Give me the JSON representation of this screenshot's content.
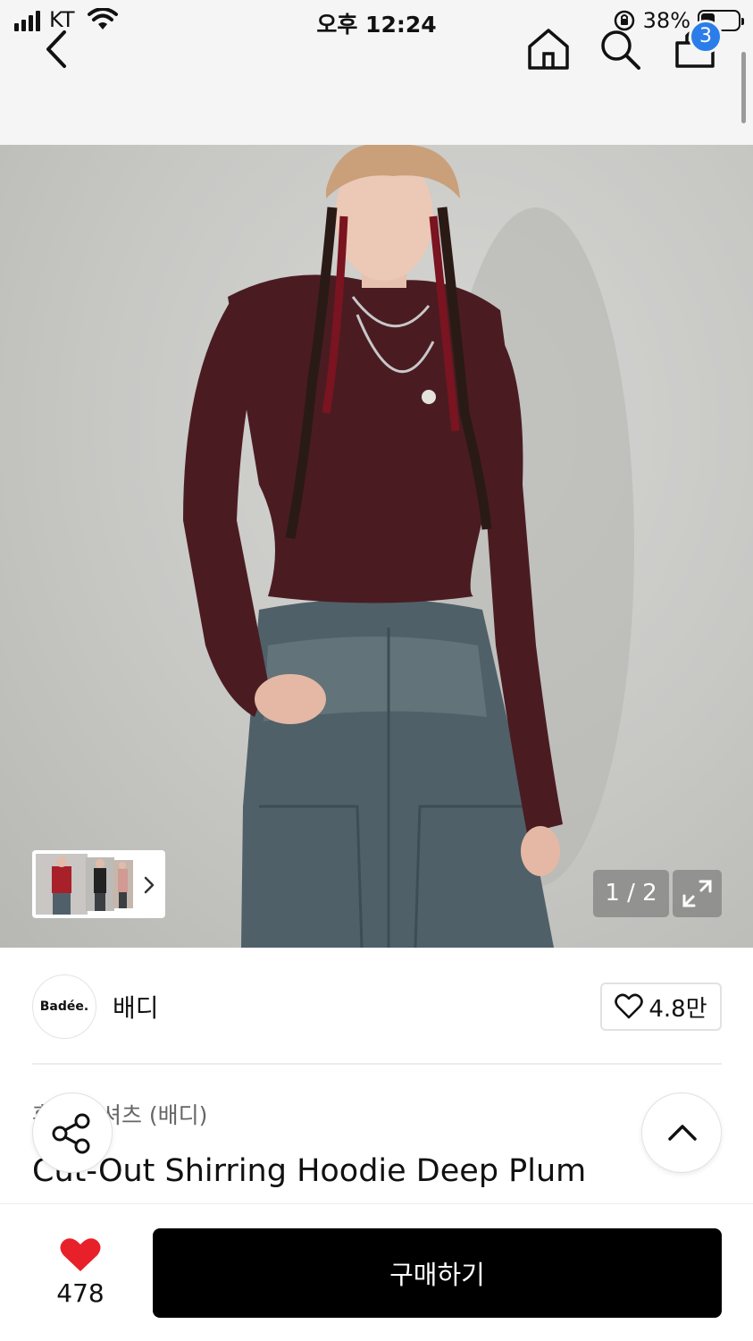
{
  "status_bar": {
    "carrier": "KT",
    "time": "오후 12:24",
    "battery_percent": "38%",
    "battery_level": 0.38
  },
  "nav": {
    "cart_count": "3",
    "icons": [
      "chevron-left-icon",
      "home-icon",
      "search-icon",
      "cart-icon"
    ]
  },
  "gallery": {
    "page_counter": "1 / 2",
    "thumbnail_count": 3
  },
  "brand": {
    "logo_text": "Badée.",
    "name": "배디",
    "like_count": "4.8만"
  },
  "product": {
    "category": "후드 티셔츠 (배디)",
    "title": "Cut-Out Shirring Hoodie Deep Plum"
  },
  "bottom": {
    "like_count": "478",
    "buy_label": "구매하기"
  },
  "colors": {
    "heart": "#e8202a",
    "badge": "#2b7de9",
    "buy_button": "#000000",
    "shirt": "#4a1c22",
    "denim": "#4f6068"
  }
}
